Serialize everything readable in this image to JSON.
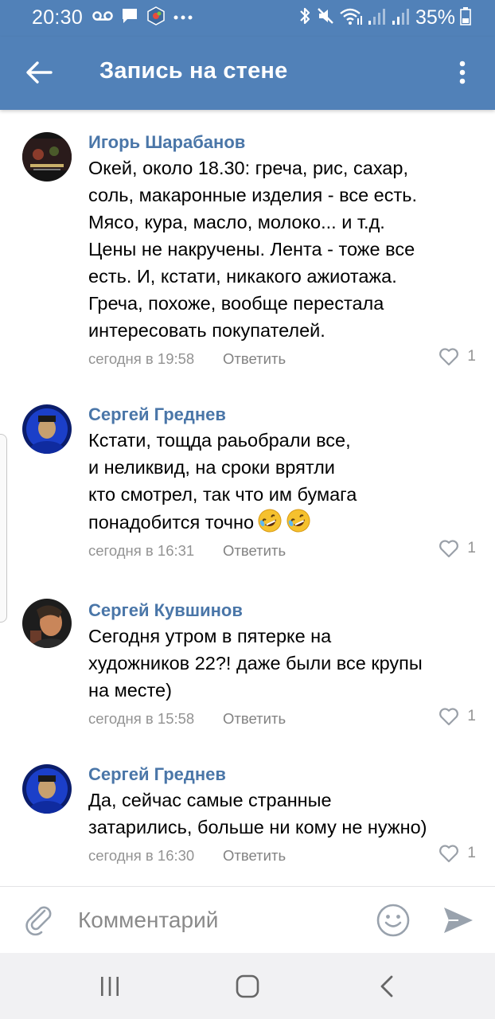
{
  "status_bar": {
    "time": "20:30",
    "battery": "35%",
    "left_icons": [
      "voicemail-icon",
      "chat-icon",
      "app-icon",
      "more-dots-icon"
    ],
    "right_icons": [
      "bluetooth-icon",
      "mute-icon",
      "wifi-icon",
      "signal-icon",
      "signal-icon",
      "battery-icon"
    ]
  },
  "header": {
    "title": "Запись на стене",
    "back_icon": "arrow-left-icon",
    "more_icon": "more-vertical-icon",
    "background": "#5181b8"
  },
  "comments": [
    {
      "author": "Игорь Шарабанов",
      "text": "Окей, около 18.30: греча, рис, сахар,\nсоль, макаронные изделия - все есть.\nМясо, кура, масло, молоко... и т.д.\nЦены не накручены. Лента - тоже все\nесть. И, кстати, никакого ажиотажа.\nГреча, похоже, вообще перестала\nинтересовать покупателей.",
      "time": "сегодня в 19:58",
      "reply": "Ответить",
      "likes": "1"
    },
    {
      "author": "Сергей Греднев",
      "text": "Кстати, тощда раьобрали все,\nи неликвид, на сроки врятли\nкто смотрел, так что им бумага\nпонадобится точно",
      "emojis": [
        "rofl-emoji-icon",
        "rofl-emoji-icon"
      ],
      "time": "сегодня в 16:31",
      "reply": "Ответить",
      "likes": "1"
    },
    {
      "author": "Сергей Кувшинов",
      "text": "Сегодня утром в пятерке на\nхудожников 22?! даже были все крупы\nна месте)",
      "time": "сегодня в 15:58",
      "reply": "Ответить",
      "likes": "1"
    },
    {
      "author": "Сергей Греднев",
      "text": "Да, сейчас самые странные\nзатарились, больше ни кому не нужно)",
      "time": "сегодня в 16:30",
      "reply": "Ответить",
      "likes": "1"
    }
  ],
  "composer": {
    "placeholder": "Комментарий",
    "attach_icon": "paperclip-icon",
    "emoji_icon": "smiley-icon",
    "send_icon": "send-icon"
  },
  "nav_bar": {
    "icons": [
      "recent-apps-icon",
      "home-icon",
      "back-icon"
    ]
  },
  "colors": {
    "accent": "#5181b8",
    "author": "#4a76a8",
    "meta": "#939393"
  }
}
